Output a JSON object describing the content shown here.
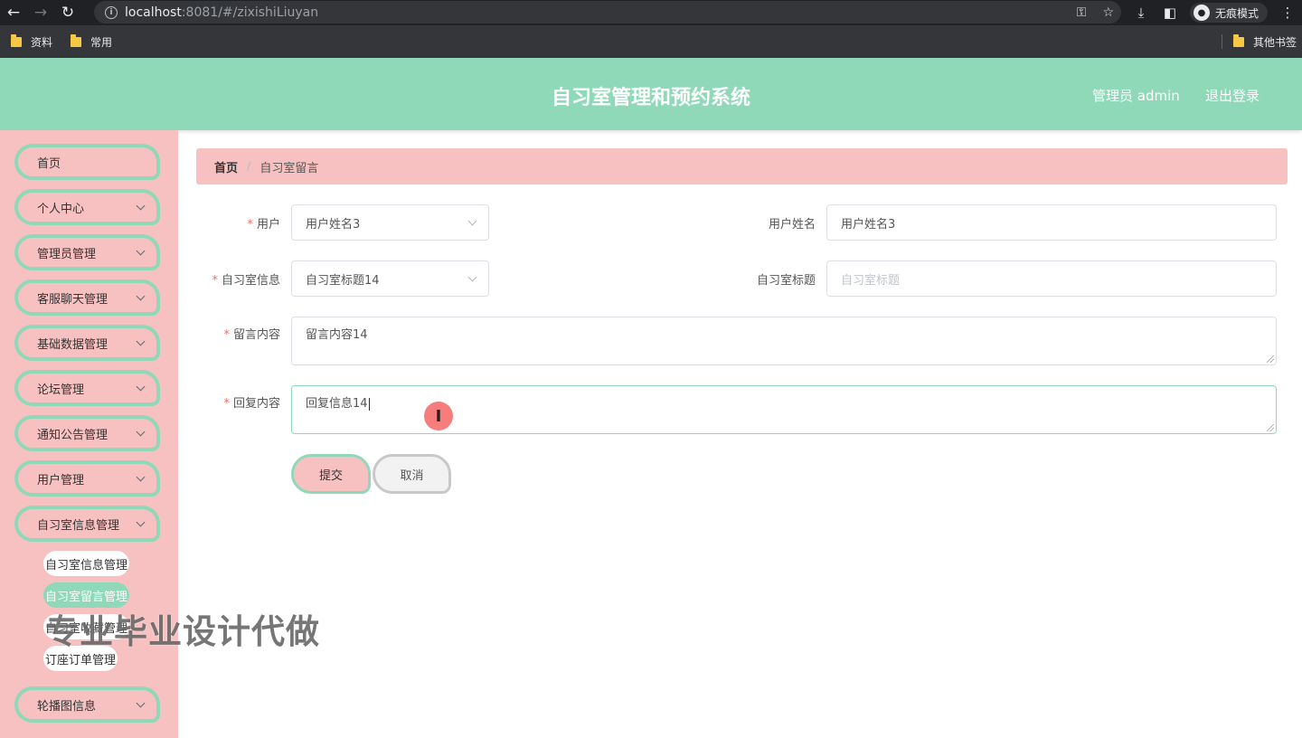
{
  "browser": {
    "url_host": "localhost",
    "url_rest": ":8081/#/zixishiLiuyan",
    "incognito_label": "无痕模式",
    "bookmarks": [
      "资料",
      "常用"
    ],
    "other_bookmarks": "其他书签"
  },
  "header": {
    "title": "自习室管理和预约系统",
    "user": "管理员 admin",
    "logout": "退出登录"
  },
  "sidebar": {
    "items": [
      {
        "label": "首页",
        "has_arrow": false
      },
      {
        "label": "个人中心",
        "has_arrow": true
      },
      {
        "label": "管理员管理",
        "has_arrow": true
      },
      {
        "label": "客服聊天管理",
        "has_arrow": true
      },
      {
        "label": "基础数据管理",
        "has_arrow": true
      },
      {
        "label": "论坛管理",
        "has_arrow": true
      },
      {
        "label": "通知公告管理",
        "has_arrow": true
      },
      {
        "label": "用户管理",
        "has_arrow": true
      },
      {
        "label": "自习室信息管理",
        "has_arrow": true
      }
    ],
    "sub_items": [
      {
        "label": "自习室信息管理",
        "active": false
      },
      {
        "label": "自习室留言管理",
        "active": true
      },
      {
        "label": "自习室收藏管理",
        "active": false
      },
      {
        "label": "订座订单管理",
        "active": false
      }
    ],
    "last_item": {
      "label": "轮播图信息",
      "has_arrow": true
    }
  },
  "breadcrumb": {
    "home": "首页",
    "separator": "/",
    "current": "自习室留言"
  },
  "form": {
    "user_label": "用户",
    "user_value": "用户姓名3",
    "user_name_label": "用户姓名",
    "user_name_value": "用户姓名3",
    "room_label": "自习室信息",
    "room_value": "自习室标题14",
    "room_title_label": "自习室标题",
    "room_title_placeholder": "自习室标题",
    "message_label": "留言内容",
    "message_value": "留言内容14",
    "reply_label": "回复内容",
    "reply_value": "回复信息14",
    "submit": "提交",
    "cancel": "取消"
  },
  "overlay": {
    "watermark": "专业毕业设计代做"
  },
  "colors": {
    "primary_green": "#8fd8b8",
    "primary_pink": "#f7c1c1",
    "required_red": "#f56c6c"
  }
}
